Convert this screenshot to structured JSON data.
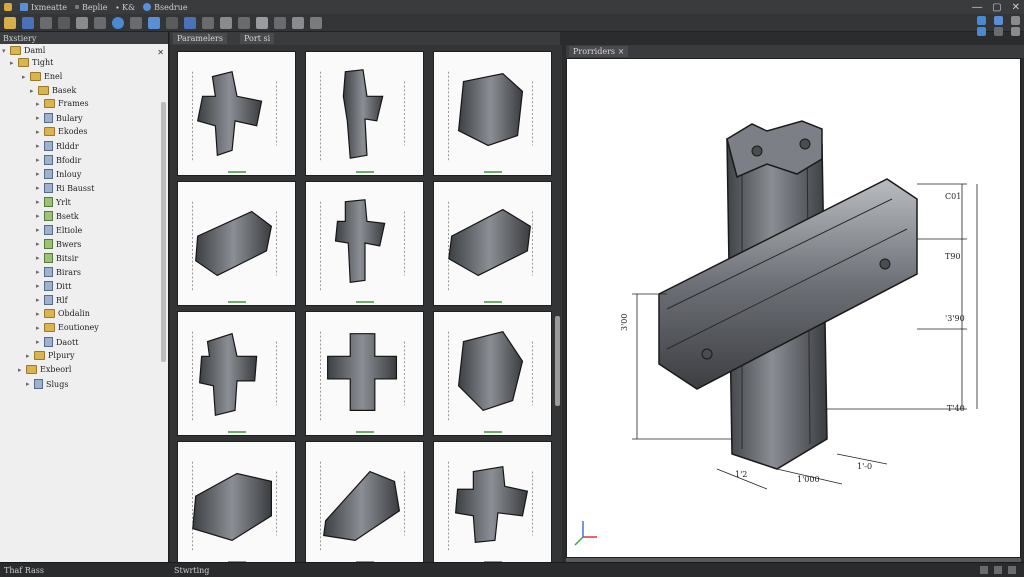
{
  "menu": {
    "items": [
      {
        "label": "Ixmeatte",
        "icon": "wrench-icon",
        "color": "#5a8fd8"
      },
      {
        "label": "Beplie",
        "icon": "",
        "color": ""
      },
      {
        "label": "∙ K&",
        "icon": "",
        "color": ""
      },
      {
        "label": "Bsedrue",
        "icon": "gear-icon",
        "color": "#5a8fd8"
      }
    ]
  },
  "window_controls": {
    "minimize": "—",
    "restore": "▢",
    "close": "✕"
  },
  "left_panel": {
    "title": "Bxstiery",
    "root": "Daml",
    "nodes": [
      {
        "label": "Tight"
      },
      {
        "label": "Enel"
      },
      {
        "label": "Basek"
      },
      {
        "label": "Frames"
      },
      {
        "label": "Bulary"
      },
      {
        "label": "Ekodes"
      },
      {
        "label": "Rlddr"
      },
      {
        "label": "Bfodir"
      },
      {
        "label": "Inlouy"
      },
      {
        "label": "Ri Bausst"
      },
      {
        "label": "Yrlt"
      },
      {
        "label": "Bsetk"
      },
      {
        "label": "Eltiole"
      },
      {
        "label": "Bwers"
      },
      {
        "label": "Bitsir"
      },
      {
        "label": "Birars"
      },
      {
        "label": "Ditt"
      },
      {
        "label": "Rlf"
      },
      {
        "label": "Obdalin"
      },
      {
        "label": "Eoutioney"
      },
      {
        "label": "Daott"
      },
      {
        "label": "Plpury"
      },
      {
        "label": "Exbeorl"
      },
      {
        "label": "Slugs"
      }
    ]
  },
  "grid_panel": {
    "tabs": [
      "Paramelers",
      "Port si"
    ]
  },
  "viewport": {
    "tab": "Prorriders",
    "dimensions": {
      "left": "3'00",
      "right_top": "C01",
      "right_upper": "T90",
      "right_mid": "'3'90",
      "right_lower": "T'40",
      "bottom_mid": "1'000",
      "bottom_left": "1'2",
      "bottom_right": "1'-0"
    }
  },
  "status": {
    "left": "Thaf Rass",
    "mid": "Stwrting"
  }
}
